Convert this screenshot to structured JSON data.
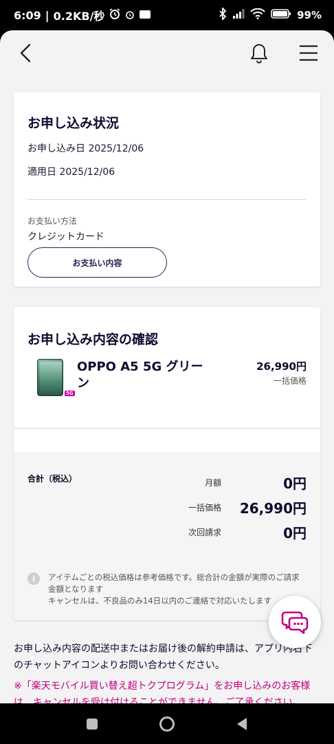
{
  "status_bar": {
    "time": "6:09",
    "net_speed": "0.2KB/秒",
    "battery": "99%"
  },
  "header": {
    "back_icon": "back-chevron-icon",
    "notification_icon": "bell-icon",
    "menu_icon": "hamburger-menu-icon"
  },
  "application_status": {
    "title": "お申し込み状況",
    "apply_date": "お申し込み日 2025/12/06",
    "effective_date": "適用日 2025/12/06",
    "payment_method_label": "お支払い方法",
    "payment_method_value": "クレジットカード",
    "payment_details_button": "お支払い内容"
  },
  "confirmation": {
    "title": "お申し込み内容の確認",
    "product": {
      "name": "OPPO A5 5G グリーン",
      "badge": "5G",
      "price": "26,990円",
      "price_label": "一括価格"
    },
    "summary": {
      "total_label": "合計（税込）",
      "rows": [
        {
          "key": "月額",
          "value": "0円"
        },
        {
          "key": "一括価格",
          "value": "26,990円"
        },
        {
          "key": "次回請求",
          "value": "0円"
        }
      ]
    },
    "note_icon": "info-icon",
    "note": "アイテムごとの税込価格は参考価格です。総合計の金額が実際のご請求金額となります\nキャンセルは、不良品のみ14日以内のご連絡で対応いたします"
  },
  "footer": {
    "cancel_info": "お申し込み内容の配送中またはお届け後の解約申請は、アプリ内右下のチャットアイコンよりお問い合わせください。",
    "warning": "※「楽天モバイル買い替え超トクプログラム」をお申し込みのお客様は、キャンセルを受け付けることができません。ご了承ください。"
  },
  "chat_fab": {
    "icon": "chat-bubbles-icon"
  },
  "colors": {
    "navy": "#0b0b2e",
    "accent_magenta": "#c2007f",
    "background": "#f3f3f3",
    "card": "#ffffff"
  }
}
